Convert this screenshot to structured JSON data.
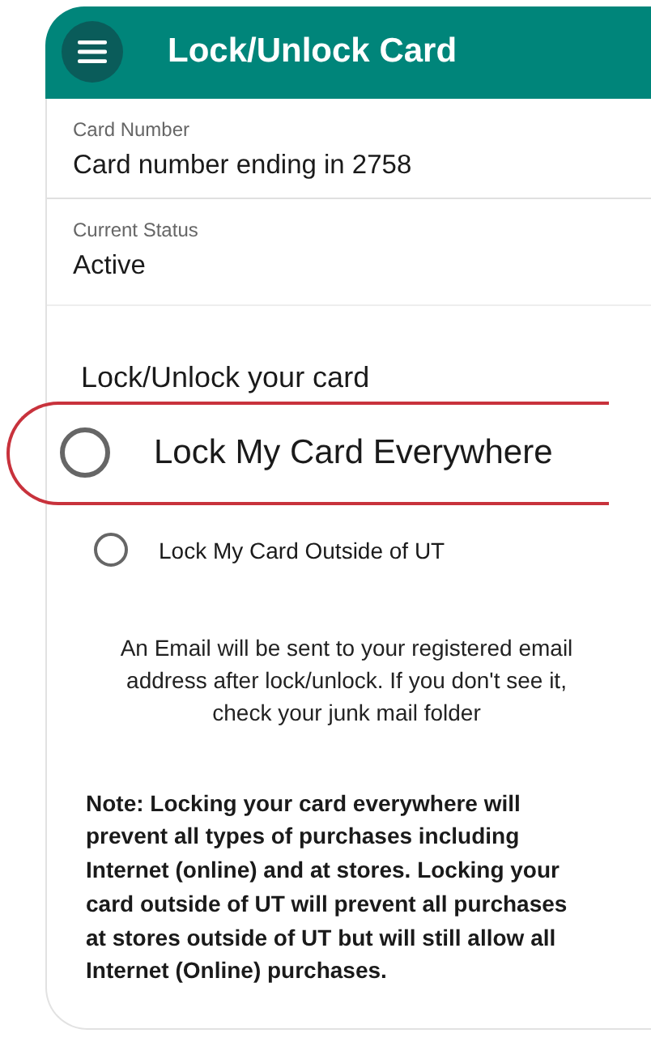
{
  "header": {
    "title": "Lock/Unlock Card"
  },
  "fields": [
    {
      "label": "Card Number",
      "value": "Card number ending in 2758"
    },
    {
      "label": "Current Status",
      "value": "Active"
    }
  ],
  "lock_section": {
    "heading": "Lock/Unlock your card",
    "options": [
      {
        "label": "Lock My Card Everywhere",
        "selected": false,
        "highlighted": true
      },
      {
        "label": "Lock My Card Outside of UT",
        "selected": false,
        "highlighted": false
      }
    ]
  },
  "info_text": "An Email will be sent to your registered email address after lock/unlock. If you don't see it, check your junk mail folder",
  "note": "Note: Locking your card everywhere will prevent all types of purchases including Internet (online) and at stores. Locking your card outside of UT will prevent all purchases at stores outside of UT but will still allow all Internet (Online) purchases."
}
